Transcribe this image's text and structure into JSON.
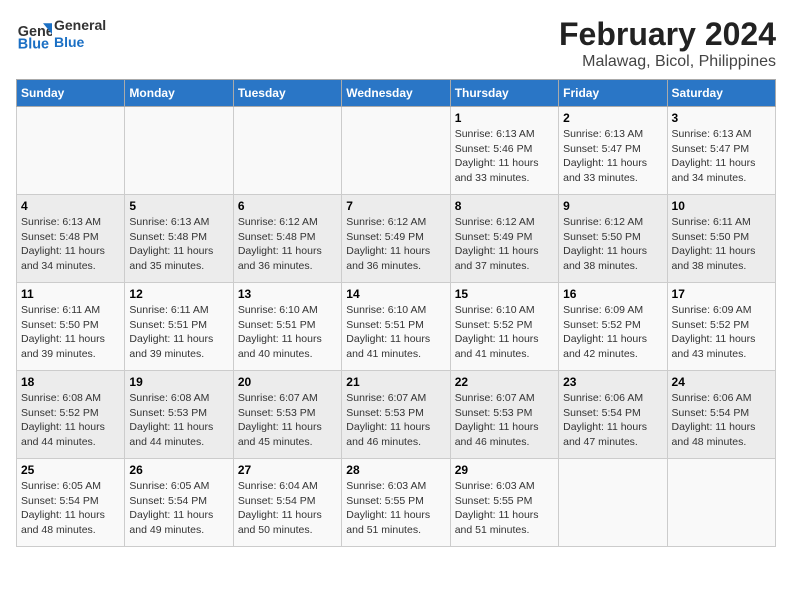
{
  "header": {
    "logo_general": "General",
    "logo_blue": "Blue",
    "title": "February 2024",
    "subtitle": "Malawag, Bicol, Philippines"
  },
  "days_of_week": [
    "Sunday",
    "Monday",
    "Tuesday",
    "Wednesday",
    "Thursday",
    "Friday",
    "Saturday"
  ],
  "weeks": [
    [
      {
        "day": "",
        "info": ""
      },
      {
        "day": "",
        "info": ""
      },
      {
        "day": "",
        "info": ""
      },
      {
        "day": "",
        "info": ""
      },
      {
        "day": "1",
        "info": "Sunrise: 6:13 AM\nSunset: 5:46 PM\nDaylight: 11 hours and 33 minutes."
      },
      {
        "day": "2",
        "info": "Sunrise: 6:13 AM\nSunset: 5:47 PM\nDaylight: 11 hours and 33 minutes."
      },
      {
        "day": "3",
        "info": "Sunrise: 6:13 AM\nSunset: 5:47 PM\nDaylight: 11 hours and 34 minutes."
      }
    ],
    [
      {
        "day": "4",
        "info": "Sunrise: 6:13 AM\nSunset: 5:48 PM\nDaylight: 11 hours and 34 minutes."
      },
      {
        "day": "5",
        "info": "Sunrise: 6:13 AM\nSunset: 5:48 PM\nDaylight: 11 hours and 35 minutes."
      },
      {
        "day": "6",
        "info": "Sunrise: 6:12 AM\nSunset: 5:48 PM\nDaylight: 11 hours and 36 minutes."
      },
      {
        "day": "7",
        "info": "Sunrise: 6:12 AM\nSunset: 5:49 PM\nDaylight: 11 hours and 36 minutes."
      },
      {
        "day": "8",
        "info": "Sunrise: 6:12 AM\nSunset: 5:49 PM\nDaylight: 11 hours and 37 minutes."
      },
      {
        "day": "9",
        "info": "Sunrise: 6:12 AM\nSunset: 5:50 PM\nDaylight: 11 hours and 38 minutes."
      },
      {
        "day": "10",
        "info": "Sunrise: 6:11 AM\nSunset: 5:50 PM\nDaylight: 11 hours and 38 minutes."
      }
    ],
    [
      {
        "day": "11",
        "info": "Sunrise: 6:11 AM\nSunset: 5:50 PM\nDaylight: 11 hours and 39 minutes."
      },
      {
        "day": "12",
        "info": "Sunrise: 6:11 AM\nSunset: 5:51 PM\nDaylight: 11 hours and 39 minutes."
      },
      {
        "day": "13",
        "info": "Sunrise: 6:10 AM\nSunset: 5:51 PM\nDaylight: 11 hours and 40 minutes."
      },
      {
        "day": "14",
        "info": "Sunrise: 6:10 AM\nSunset: 5:51 PM\nDaylight: 11 hours and 41 minutes."
      },
      {
        "day": "15",
        "info": "Sunrise: 6:10 AM\nSunset: 5:52 PM\nDaylight: 11 hours and 41 minutes."
      },
      {
        "day": "16",
        "info": "Sunrise: 6:09 AM\nSunset: 5:52 PM\nDaylight: 11 hours and 42 minutes."
      },
      {
        "day": "17",
        "info": "Sunrise: 6:09 AM\nSunset: 5:52 PM\nDaylight: 11 hours and 43 minutes."
      }
    ],
    [
      {
        "day": "18",
        "info": "Sunrise: 6:08 AM\nSunset: 5:52 PM\nDaylight: 11 hours and 44 minutes."
      },
      {
        "day": "19",
        "info": "Sunrise: 6:08 AM\nSunset: 5:53 PM\nDaylight: 11 hours and 44 minutes."
      },
      {
        "day": "20",
        "info": "Sunrise: 6:07 AM\nSunset: 5:53 PM\nDaylight: 11 hours and 45 minutes."
      },
      {
        "day": "21",
        "info": "Sunrise: 6:07 AM\nSunset: 5:53 PM\nDaylight: 11 hours and 46 minutes."
      },
      {
        "day": "22",
        "info": "Sunrise: 6:07 AM\nSunset: 5:53 PM\nDaylight: 11 hours and 46 minutes."
      },
      {
        "day": "23",
        "info": "Sunrise: 6:06 AM\nSunset: 5:54 PM\nDaylight: 11 hours and 47 minutes."
      },
      {
        "day": "24",
        "info": "Sunrise: 6:06 AM\nSunset: 5:54 PM\nDaylight: 11 hours and 48 minutes."
      }
    ],
    [
      {
        "day": "25",
        "info": "Sunrise: 6:05 AM\nSunset: 5:54 PM\nDaylight: 11 hours and 48 minutes."
      },
      {
        "day": "26",
        "info": "Sunrise: 6:05 AM\nSunset: 5:54 PM\nDaylight: 11 hours and 49 minutes."
      },
      {
        "day": "27",
        "info": "Sunrise: 6:04 AM\nSunset: 5:54 PM\nDaylight: 11 hours and 50 minutes."
      },
      {
        "day": "28",
        "info": "Sunrise: 6:03 AM\nSunset: 5:55 PM\nDaylight: 11 hours and 51 minutes."
      },
      {
        "day": "29",
        "info": "Sunrise: 6:03 AM\nSunset: 5:55 PM\nDaylight: 11 hours and 51 minutes."
      },
      {
        "day": "",
        "info": ""
      },
      {
        "day": "",
        "info": ""
      }
    ]
  ]
}
